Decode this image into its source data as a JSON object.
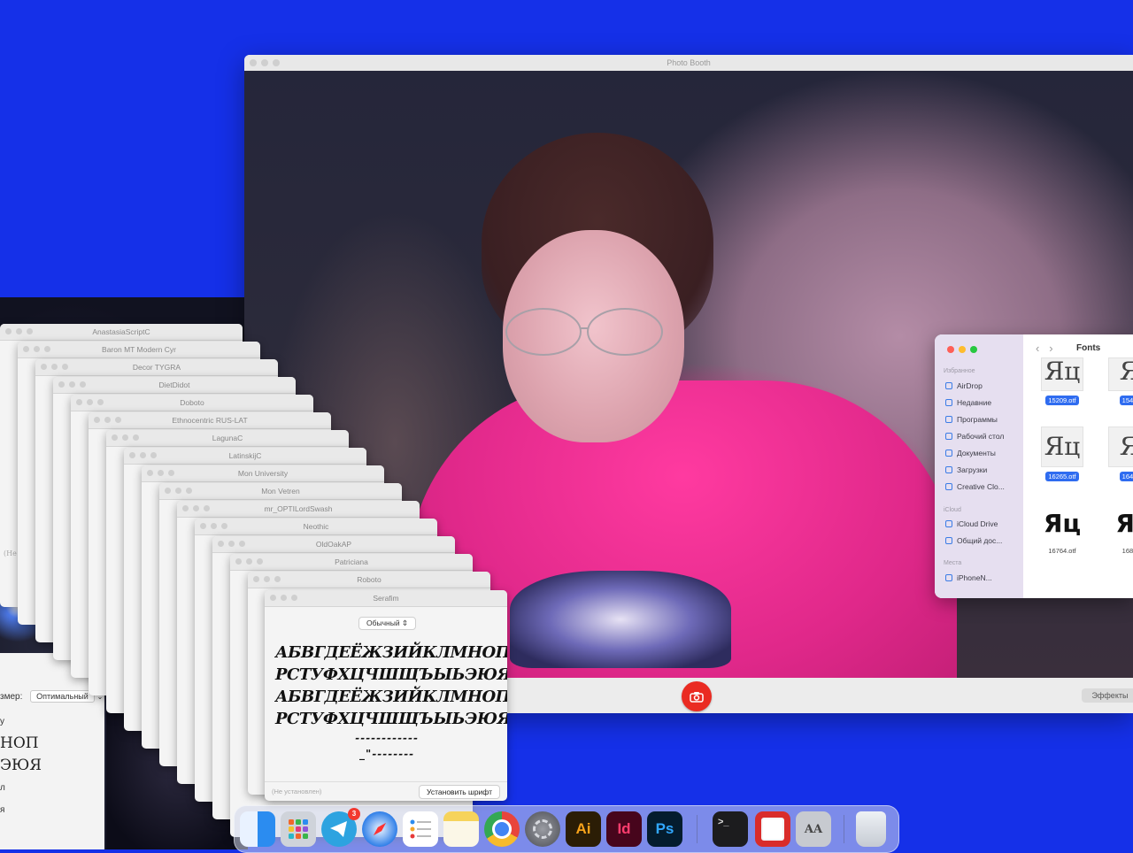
{
  "photo_booth": {
    "title": "Photo Booth",
    "effects_label": "Эффекты",
    "shutter_icon": "camera-icon"
  },
  "finder": {
    "title": "Fonts",
    "sidebar": {
      "favorites_header": "Избранное",
      "favorites": [
        "AirDrop",
        "Недавние",
        "Программы",
        "Рабочий стол",
        "Документы",
        "Загрузки",
        "Creative Clo..."
      ],
      "icloud_header": "iCloud",
      "icloud": [
        "iCloud Drive",
        "Общий дос..."
      ],
      "places_header": "Места",
      "places": [
        "iPhoneN..."
      ]
    },
    "files": [
      {
        "glyph": "Яц",
        "name": "15209.otf",
        "selected": true
      },
      {
        "glyph": "Я",
        "name": "1546",
        "selected": true
      },
      {
        "glyph": "Яц",
        "name": "16265.otf",
        "selected": true
      },
      {
        "glyph": "Я",
        "name": "1641",
        "selected": true
      },
      {
        "glyph": "Яц",
        "name": "16764.otf",
        "selected": false
      },
      {
        "glyph": "Яı",
        "name": "1686",
        "selected": false
      }
    ]
  },
  "font_windows": [
    "AnastasiaScriptC",
    "Baron MT Modern Cyr",
    "Decor TYGRA",
    "DietDidot",
    "Doboto",
    "Ethnocentric RUS-LAT",
    "LagunaC",
    "LatinskijC",
    "Mon University",
    "Mon Vetren",
    "mr_OPTILordSwash",
    "Neothic",
    "OldOakAP",
    "Patriciana",
    "Roboto",
    "Serafim"
  ],
  "front_font": {
    "style": "Обычный",
    "sample_lines": [
      "АБВГДЕЁЖЗИЙКЛМНОП",
      "РСТУФХЦЧШЩЪЫЬЭЮЯ",
      "АБВГДЕЁЖЗИЙКЛМНОП",
      "РСТУФХЦЧШЩЪЫЬЭЮЯ",
      "------------",
      "_\"--------"
    ],
    "status": "(Не установлен)",
    "install_label": "Установить шрифт"
  },
  "left_window": {
    "size_label": "змер:",
    "size_value": "Оптимальный",
    "lines": [
      "у",
      "НОП",
      "ЭЮЯ",
      "л",
      "я"
    ]
  },
  "peek_window_label": "(Не уста",
  "peek_window_label2": "(Не установлен)",
  "dock": {
    "apps": [
      {
        "name": "finder-icon",
        "label": ""
      },
      {
        "name": "launchpad-icon",
        "label": ""
      },
      {
        "name": "telegram-icon",
        "label": "",
        "badge": "3"
      },
      {
        "name": "safari-icon",
        "label": ""
      },
      {
        "name": "reminders-icon",
        "label": ""
      },
      {
        "name": "notes-icon",
        "label": ""
      },
      {
        "name": "chrome-icon",
        "label": ""
      },
      {
        "name": "system-settings-icon",
        "label": ""
      },
      {
        "name": "illustrator-icon",
        "label": "Ai"
      },
      {
        "name": "indesign-icon",
        "label": "Id"
      },
      {
        "name": "photoshop-icon",
        "label": "Ps"
      },
      {
        "name": "terminal-icon",
        "label": ">_"
      },
      {
        "name": "photo-booth-icon",
        "label": ""
      },
      {
        "name": "font-book-icon",
        "label": "AA"
      },
      {
        "name": "trash-icon",
        "label": ""
      }
    ]
  },
  "colors": {
    "desktop": "#1530e8",
    "shutter": "#ea2b22",
    "selection": "#2f6cf0"
  }
}
